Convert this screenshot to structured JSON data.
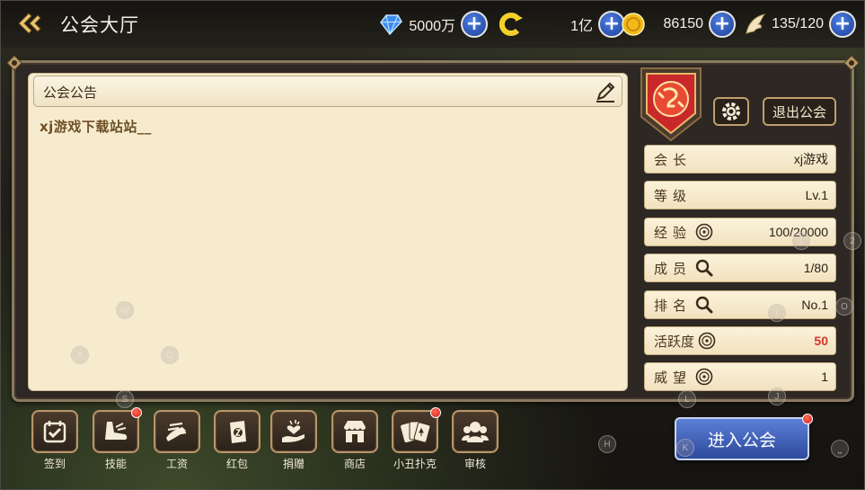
{
  "header": {
    "title": "公会大厅",
    "resources": [
      {
        "name": "diamond",
        "icon": "diamond-icon",
        "value": "5000万"
      },
      {
        "name": "coupon",
        "icon": "c-coin-icon",
        "value": "1亿"
      },
      {
        "name": "gold",
        "icon": "gold-coin-icon",
        "value": "86150"
      },
      {
        "name": "stamina",
        "icon": "wing-icon",
        "value": "135/120"
      }
    ],
    "plus_label": "+"
  },
  "notice": {
    "title": "公会公告",
    "body": "xj游戏下载站站__"
  },
  "guild": {
    "quit_label": "退出公会",
    "rows": [
      {
        "label": "会长",
        "value": "xj游戏"
      },
      {
        "label": "等级",
        "value": "Lv.1"
      },
      {
        "label": "经验",
        "value": "100/20000"
      },
      {
        "label": "成员",
        "value": "1/80"
      },
      {
        "label": "排名",
        "value": "No.1"
      },
      {
        "label": "活跃度",
        "value": "50"
      },
      {
        "label": "威望",
        "value": "1"
      }
    ]
  },
  "toolbar": {
    "items": [
      {
        "label": "签到",
        "badge": false
      },
      {
        "label": "技能",
        "badge": true
      },
      {
        "label": "工资",
        "badge": false
      },
      {
        "label": "红包",
        "badge": false
      },
      {
        "label": "捐赠",
        "badge": false
      },
      {
        "label": "商店",
        "badge": false
      },
      {
        "label": "小丑扑克",
        "badge": true
      },
      {
        "label": "审核",
        "badge": false
      }
    ],
    "enter_label": "进入公会"
  },
  "key_hints": [
    "W",
    "A",
    "D",
    "S",
    "1",
    "2",
    "I",
    "O",
    "L",
    "J",
    "K",
    "H",
    "⎵"
  ],
  "colors": {
    "accent_blue": "#2d4a9c",
    "gold_border": "#b8956a",
    "parchment": "#f6ebcd",
    "active_red": "#d8322b"
  }
}
